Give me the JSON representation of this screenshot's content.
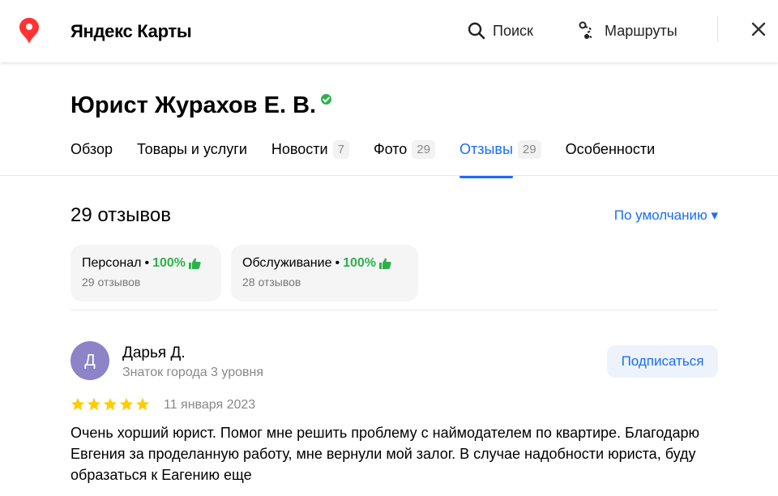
{
  "header": {
    "brand": "Яндекс Карты",
    "search_label": "Поиск",
    "routes_label": "Маршруты"
  },
  "org": {
    "title": "Юрист Журахов Е. В."
  },
  "tabs": [
    {
      "label": "Обзор",
      "count": null
    },
    {
      "label": "Товары и услуги",
      "count": null
    },
    {
      "label": "Новости",
      "count": "7"
    },
    {
      "label": "Фото",
      "count": "29"
    },
    {
      "label": "Отзывы",
      "count": "29",
      "active": true
    },
    {
      "label": "Особенности",
      "count": null
    }
  ],
  "reviews": {
    "count_label": "29 отзывов",
    "sort_label": "По умолчанию ▾",
    "aspects": [
      {
        "name": "Персонал",
        "percent": "100%",
        "reviews": "29 отзывов"
      },
      {
        "name": "Обслуживание",
        "percent": "100%",
        "reviews": "28 отзывов"
      }
    ],
    "items": [
      {
        "avatar_letter": "Д",
        "author": "Дарья Д.",
        "level": "Знаток города 3 уровня",
        "subscribe_label": "Подписаться",
        "rating": 5,
        "date": "11 января 2023",
        "text": "Очень хорший юрист. Помог мне решить проблему с наймодателем по квартире. Благодарю Евгения за проделанную работу, мне вернули мой залог. В случае надобности юриста, буду образаться к Еагению еще"
      }
    ]
  },
  "colors": {
    "accent": "#196dff",
    "positive": "#2db24a",
    "star": "#fc0",
    "avatar": "#8c83c9",
    "pin": "#f33"
  }
}
